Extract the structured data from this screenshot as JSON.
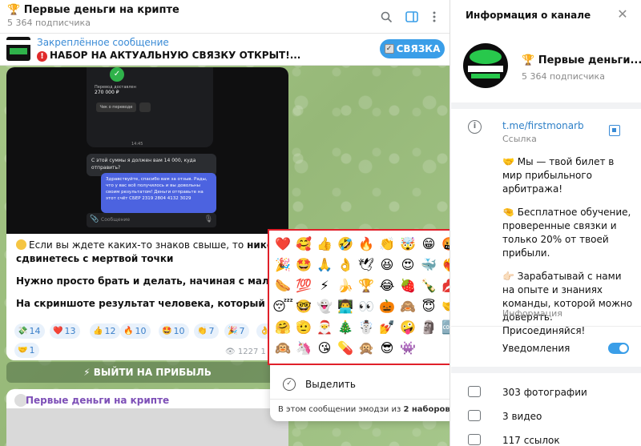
{
  "chat": {
    "title": "🏆 Первые деньги на крипте",
    "subtitle": "5 364 подписчика",
    "pinned_label": "Закреплённое сообщение",
    "pinned_text": "НАБОР НА АКТУАЛЬНУЮ СВЯЗКУ ОТКРЫТ!...",
    "pinned_button": "СВЯЗКА",
    "message": {
      "phone": {
        "amount_label": "Перевод доставлен",
        "amount": "270 000 ₽",
        "button": "Чек о переводе",
        "time": "14:45"
      },
      "bubble_in": "С этой суммы я должен вам 14 000, куда отправить?",
      "bubble_out": "Здравствуйте, спасибо вам за отзыв. Рады, что у вас всё получилось и вы довольны своим результатом! Деньги отправьте на этот счёт СБЕР 2319 2804 4132 3029",
      "phone_input": "Сообщение",
      "p1_a": "Если вы ждете каких-то знаков свыше, то ",
      "p1_b": "никогда не",
      "p1_c": "сдвинетесь с мертвой точки",
      "p2": "Нужно просто брать и делать, начиная с малых шагов",
      "p3": "На скриншоте результат человека, который уже написал м",
      "views": "1227",
      "views_trail": "1"
    },
    "reactions": [
      {
        "emoji": "💸",
        "count": "14",
        "color": "#7ed07a"
      },
      {
        "emoji": "❤️",
        "count": "13",
        "color": "#e53935"
      },
      {
        "emoji": "👍",
        "count": "12",
        "color": "#f5c542"
      },
      {
        "emoji": "🔥",
        "count": "10",
        "color": "#ff7a1a"
      },
      {
        "emoji": "🤩",
        "count": "10",
        "color": "#f5c542"
      },
      {
        "emoji": "👏",
        "count": "7",
        "color": "#f5c542"
      },
      {
        "emoji": "🎉",
        "count": "7",
        "color": "#c57ae0"
      },
      {
        "emoji": "👌",
        "count": "7",
        "color": "#f5c542"
      },
      {
        "emoji": "🤝",
        "count": "1",
        "color": "#f5c542"
      }
    ],
    "cta_button": "⚡ ВЫЙТИ НА ПРИБЫЛЬ",
    "next_message_title": "Первые деньги на крипте"
  },
  "context_menu": {
    "select": "Выделить",
    "footer_a": "В этом сообщении эмодзи из ",
    "footer_b": "2 наборов",
    "footer_c": "."
  },
  "emoji_panel": {
    "emojis": [
      "❤️",
      "🥰",
      "👍",
      "🤣",
      "🔥",
      "👏",
      "🤯",
      "😁",
      "🤬",
      "😱",
      "🎉",
      "🤩",
      "🙏",
      "👌",
      "🕊",
      "😆",
      "😍",
      "🐳",
      "❤️‍🔥",
      "🌚",
      "🌭",
      "💯",
      "⚡",
      "🍌",
      "🏆",
      "😂",
      "🍓",
      "🍾",
      "💋",
      "😈",
      "😴",
      "🤓",
      "👻",
      "👨‍💻",
      "👀",
      "🎃",
      "🙈",
      "😇",
      "🤝",
      "✍️",
      "🤗",
      "🫡",
      "🎅",
      "🎄",
      "☃️",
      "💅",
      "🤪",
      "🗿",
      "🆒",
      "💘",
      "🙉",
      "🦄",
      "😘",
      "💊",
      "🙊",
      "😎",
      "👾"
    ]
  },
  "info_panel": {
    "title": "Информация о канале",
    "channel_name": "🏆 Первые деньги...",
    "subscribers": "5 364 подписчика",
    "link": "t.me/firstmonarb",
    "link_caption": "Ссылка",
    "description": [
      "🤝 Мы — твой билет в мир прибыльного арбитража!",
      "🤏 Бесплатное обучение, проверенные связки и только 20% от твоей прибыли.",
      "👉🏻 Зарабатывай с нами на опыте и знаниях команды, которой можно доверять. Присоединяйся!"
    ],
    "description_caption": "Информация",
    "notifications": "Уведомления",
    "notifications_on": true,
    "media": [
      {
        "icon": "photo-icon",
        "label": "303 фотографии"
      },
      {
        "icon": "video-icon",
        "label": "3 видео"
      },
      {
        "icon": "link-icon",
        "label": "117 ссылок"
      }
    ]
  },
  "colors": {
    "accent": "#3a9ee8",
    "link": "#2d7fc7",
    "highlight_border": "#e0202a",
    "chat_bg": "#9fbf84"
  }
}
